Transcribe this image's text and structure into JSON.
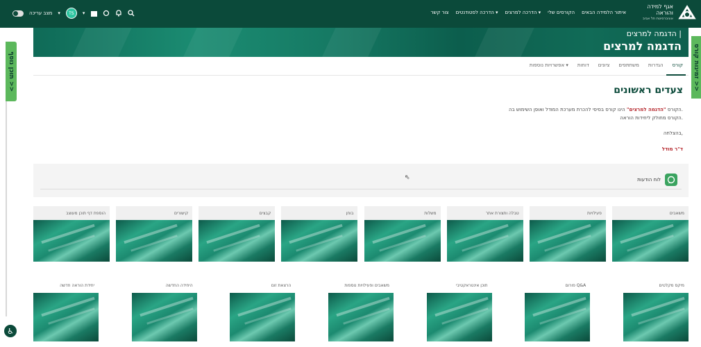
{
  "topbar": {
    "brand_line1": "אגף למידה",
    "brand_line2": "והוראה",
    "brand_small": "אוניברסיטת תל אביב",
    "nav": [
      "איתור הלמידה הבאים",
      "הקורסים שלי",
      "הדרכה למרצים ▾",
      "הדרכה לסטודנטים ▾",
      "צור קשר"
    ],
    "edit_mode": "מצב עריכה",
    "user_initials": "TS"
  },
  "hero": {
    "breadcrumb": "הדגמה למרצים |",
    "title": "הדגמה למרצים"
  },
  "side": {
    "left_tab": "תוכן נוסף >>",
    "right_tab": "זמינות קורס >>"
  },
  "course_tabs": [
    "קורס",
    "הגדרות",
    "משתתפים",
    "ציונים",
    "דוחות",
    "אפשרויות נוספות ▾"
  ],
  "content": {
    "section_title": "צעדים ראשונים",
    "para1_prefix": "הקורס ",
    "para1_highlight": "\"הדגמה למרצים\"",
    "para1_suffix": " הינו קורס בסיסי להכרת מערכת המודל ואופן השימוש בה.",
    "para2": "הקורס מחולק ליחידות הוראה.",
    "para3": "בהצלחה,",
    "signature": "ד\"ר מודל"
  },
  "forum": {
    "label": "לוח הודעות"
  },
  "tiles_row1": [
    "משאבים",
    "פעילויות",
    "טבלה ותצורת אתר",
    "משלות",
    "בוחן",
    "קבצים",
    "קישורים",
    "הוספת דף תוכן מעוצב"
  ],
  "tiles_row2": [
    "מיקס מקלטים",
    "פורום Q&A",
    "תוכן אינטראקטיבי",
    "משאבים ופעילויות נוספות",
    "הרצאת זום",
    "היחידה החדשה",
    "יחידת הוראה חדשה"
  ],
  "colors": {
    "primary": "#0b4a3a",
    "accent_green": "#5cb85c",
    "highlight_red": "#b5262c"
  }
}
